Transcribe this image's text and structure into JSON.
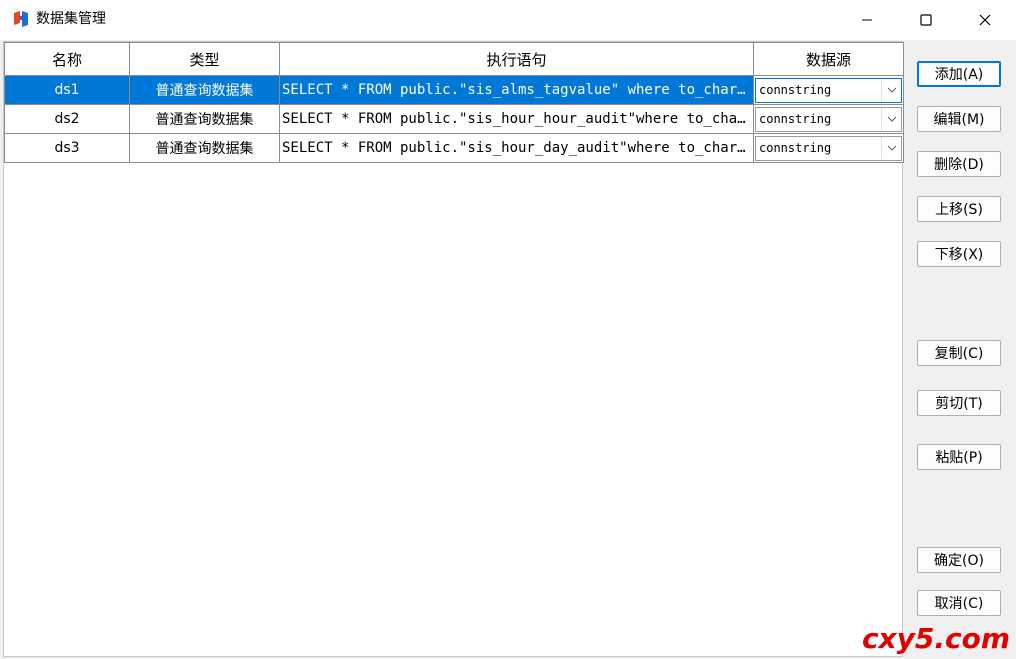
{
  "window": {
    "title": "数据集管理",
    "icon": "app-logo-icon",
    "controls": [
      "minimize-icon",
      "maximize-icon",
      "close-icon"
    ]
  },
  "grid": {
    "columns": [
      "名称",
      "类型",
      "执行语句",
      "数据源"
    ],
    "rows": [
      {
        "name": "ds1",
        "type": "普通查询数据集",
        "sql": "SELECT * FROM public.\"sis_alms_tagvalue\" where to_char(calc...",
        "source": "connstring",
        "selected": true
      },
      {
        "name": "ds2",
        "type": "普通查询数据集",
        "sql": "SELECT * FROM public.\"sis_hour_hour_audit\"where to_char(tim...",
        "source": "connstring",
        "selected": false
      },
      {
        "name": "ds3",
        "type": "普通查询数据集",
        "sql": "SELECT * FROM public.\"sis_hour_day_audit\"where to_char(time...",
        "source": "connstring",
        "selected": false
      }
    ]
  },
  "buttons": {
    "add": "添加(A)",
    "edit": "编辑(M)",
    "delete": "删除(D)",
    "move_up": "上移(S)",
    "move_down": "下移(X)",
    "copy": "复制(C)",
    "cut": "剪切(T)",
    "paste": "粘贴(P)",
    "ok": "确定(O)",
    "cancel": "取消(C)"
  },
  "watermark": "cxy5.com",
  "colors": {
    "selection": "#0078d7",
    "watermark": "#e00000"
  }
}
